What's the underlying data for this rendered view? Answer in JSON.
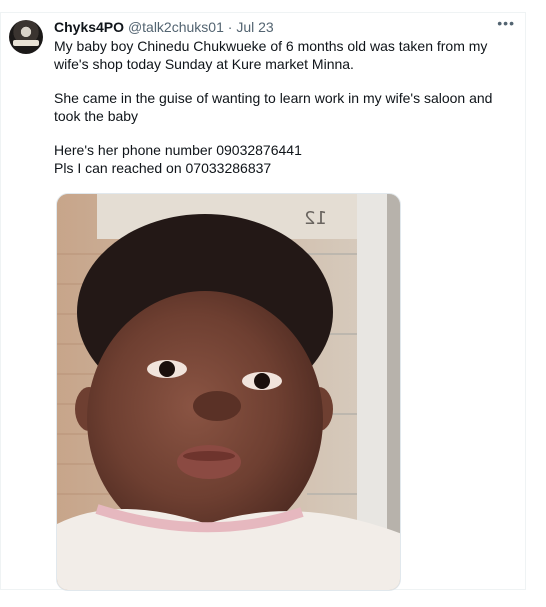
{
  "tweet": {
    "display_name": "Chyks4PO",
    "handle": "@talk2chuks01",
    "separator": "·",
    "date": "Jul 23",
    "more_label": "•••",
    "lines": [
      "My baby boy Chinedu Chukwueke of 6 months old was taken from my",
      "wife's shop today Sunday at Kure market Minna.",
      "She came in the guise of wanting to learn work in my wife's saloon and",
      "took the baby",
      "Here's her phone number 09032876441",
      "Pls I can reached on 07033286837"
    ]
  },
  "media": {
    "background_sign_text": "12",
    "image_alt": "baby-photo"
  },
  "colors": {
    "text_primary": "#0f1419",
    "text_secondary": "#536471",
    "border": "#eff3f4"
  },
  "icons": {
    "more": "more-options-icon"
  }
}
